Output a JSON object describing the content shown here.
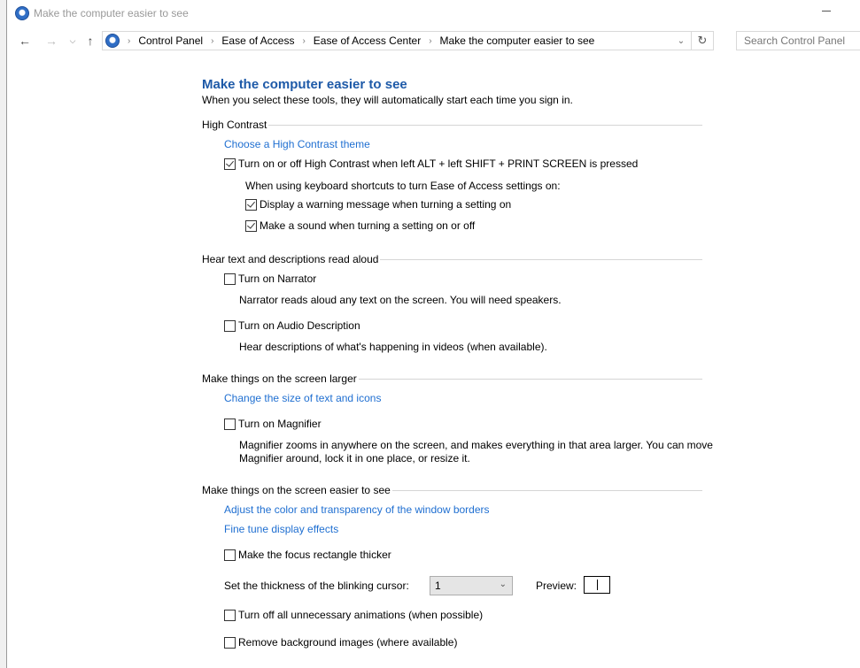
{
  "window": {
    "title": "Make the computer easier to see",
    "app_icon": "ease-of-access-icon"
  },
  "navigation": {
    "back_icon": "←",
    "forward_icon": "→",
    "recent_icon": "⌄",
    "up_icon": "↑",
    "breadcrumb": [
      "Control Panel",
      "Ease of Access",
      "Ease of Access Center",
      "Make the computer easier to see"
    ],
    "separator": "›",
    "dropdown_icon": "⌄",
    "refresh_icon": "↻",
    "search_placeholder": "Search Control Panel"
  },
  "page": {
    "title": "Make the computer easier to see",
    "subtitle": "When you select these tools, they will automatically start each time you sign in."
  },
  "sections": {
    "high_contrast": {
      "header": "High Contrast",
      "link": "Choose a High Contrast theme",
      "toggle_label": "Turn on or off High Contrast when left ALT + left SHIFT + PRINT SCREEN is pressed",
      "toggle_checked": true,
      "shortcut_note": "When using keyboard shortcuts to turn Ease of Access settings on:",
      "warning_label": "Display a warning message when turning a setting on",
      "warning_checked": true,
      "sound_label": "Make a sound when turning a setting on or off",
      "sound_checked": true
    },
    "read_aloud": {
      "header": "Hear text and descriptions read aloud",
      "narrator_label": "Turn on Narrator",
      "narrator_checked": false,
      "narrator_desc": "Narrator reads aloud any text on the screen. You will need speakers.",
      "audio_desc_label": "Turn on Audio Description",
      "audio_desc_checked": false,
      "audio_desc_desc": "Hear descriptions of what's happening in videos (when available)."
    },
    "larger": {
      "header": "Make things on the screen larger",
      "link": "Change the size of text and icons",
      "magnifier_label": "Turn on Magnifier",
      "magnifier_checked": false,
      "magnifier_desc_line1": "Magnifier zooms in anywhere on the screen, and makes everything in that area larger. You can move",
      "magnifier_desc_line2": "Magnifier around, lock it in one place, or resize it."
    },
    "easier": {
      "header": "Make things on the screen easier to see",
      "link_borders": "Adjust the color and transparency of the window borders",
      "link_display": "Fine tune display effects",
      "focus_label": "Make the focus rectangle thicker",
      "focus_checked": false,
      "cursor_label": "Set the thickness of the blinking cursor:",
      "cursor_value": "1",
      "preview_label": "Preview:",
      "animations_label": "Turn off all unnecessary animations (when possible)",
      "animations_checked": false,
      "background_label": "Remove background images (where available)",
      "background_checked": false
    }
  },
  "colors": {
    "link": "#1f6fd1",
    "title": "#1e5aa8"
  }
}
